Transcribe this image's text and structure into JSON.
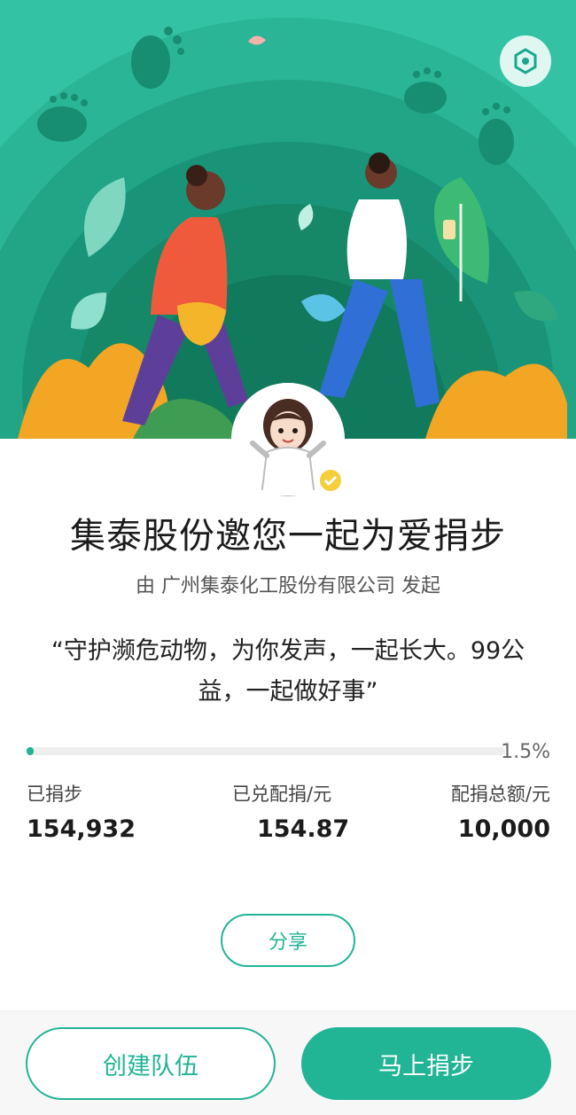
{
  "hero": {
    "scene": "walking-people-illustration"
  },
  "header": {
    "settings_icon": "hexagon-settings-icon"
  },
  "campaign": {
    "title": "集泰股份邀您一起为爱捐步",
    "initiator": "由 广州集泰化工股份有限公司 发起",
    "quote": "“守护濒危动物，为你发声，一起长大。99公益，一起做好事”"
  },
  "progress": {
    "percent": 1.5,
    "label": "1.5%"
  },
  "stats": {
    "steps_label": "已捐步",
    "steps_value": "154,932",
    "matched_label": "已兑配捐/元",
    "matched_value": "154.87",
    "total_label": "配捐总额/元",
    "total_value": "10,000"
  },
  "actions": {
    "share_label": "分享",
    "create_team_label": "创建队伍",
    "donate_label": "马上捐步"
  },
  "colors": {
    "accent": "#21b495",
    "hero_bg": "#1aa88c"
  }
}
